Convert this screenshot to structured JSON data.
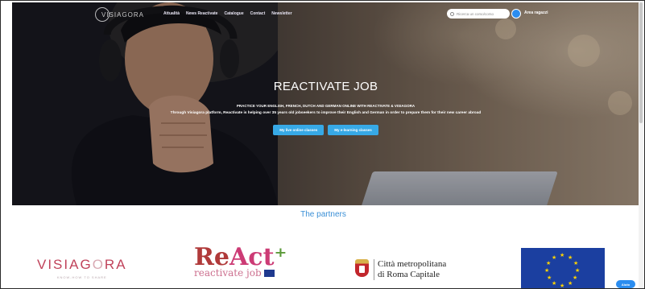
{
  "nav": {
    "logo_text": "VISIAGORA",
    "links": [
      "Attualità",
      "News Reactivate",
      "Catalogue",
      "Contact",
      "Newsletter"
    ],
    "search_placeholder": "Ricerca un corso/corso",
    "login_label": "Area ragazzi"
  },
  "hero": {
    "title": "REACTIVATE JOB",
    "subtitle": "PRACTICE YOUR ENGLISH, FRENCH, DUTCH AND GERMAN ONLINE WITH REACTIVATE & VISIAGORA",
    "description": "Through Visiagora platform, Reactivate is helping over 35 years old jobseekers to improve their English and German in order to prepare them for their new career abroad",
    "buttons": [
      "My live online classes",
      "My e-learning classes"
    ]
  },
  "partners": {
    "title": "The partners",
    "visiagora": {
      "name_a": "VISIAG",
      "name_o": "O",
      "name_b": "RA",
      "tagline": "KNOW-HOW TO SHARE"
    },
    "react": {
      "big_a": "Re",
      "big_b": "Act",
      "small": "reactivate job"
    },
    "roma": {
      "line1": "Città metropolitana",
      "line2": "di Roma Capitale"
    }
  },
  "help_label": "Aiuto",
  "colors": {
    "accent_blue": "#37a9e6",
    "partners_title": "#3a8fd6",
    "eu_blue": "#1b3fa0",
    "eu_star": "#ffd200"
  },
  "icons": [
    "search-icon",
    "user-avatar-icon",
    "help-icon"
  ]
}
